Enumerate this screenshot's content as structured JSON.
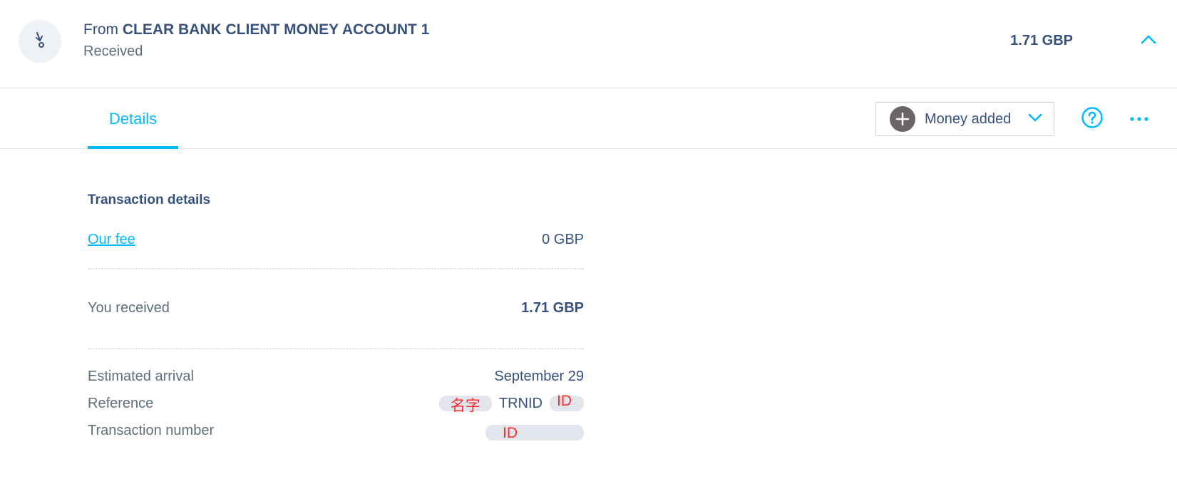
{
  "transaction": {
    "direction_prefix": "From",
    "counterparty": "CLEAR BANK CLIENT MONEY ACCOUNT 1",
    "status": "Received",
    "amount": "1.71 GBP"
  },
  "tabs": [
    {
      "label": "Details",
      "active": true
    }
  ],
  "category": {
    "label": "Money added",
    "icon": "plus-icon"
  },
  "details": {
    "section_title": "Transaction details",
    "fee_label": "Our fee",
    "fee_value": "0 GBP",
    "received_label": "You received",
    "received_value": "1.71 GBP",
    "arrival_label": "Estimated arrival",
    "arrival_value": "September 29",
    "reference_label": "Reference",
    "reference_parts": {
      "name_mark": "名字",
      "trnid_text": "TRNID",
      "id_mark": "ID"
    },
    "transaction_number_label": "Transaction number",
    "transaction_number_mark": "ID"
  },
  "colors": {
    "accent": "#00b9ff",
    "text_primary": "#37517e",
    "text_secondary": "#5d7079",
    "annotation_red": "#ff2a2a"
  },
  "icons": [
    "receive-arrow-icon",
    "chevron-up-icon",
    "plus-icon",
    "chevron-down-icon",
    "help-icon",
    "more-options-icon"
  ]
}
